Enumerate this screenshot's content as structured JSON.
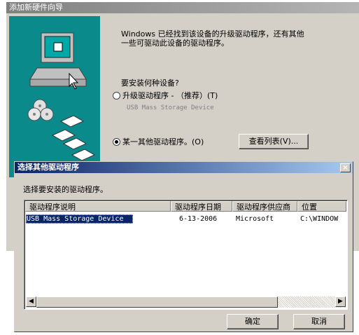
{
  "wizard": {
    "title": "添加新硬件向导",
    "message_line1": "Windows 已经找到该设备的升级驱动程序，还有其他",
    "message_line2": "一些可驱动此设备的驱动程序。",
    "question": "要安装何种设备?",
    "option_upgrade": "升级驱动程序 - （推荐）(T)",
    "option_upgrade_sub": "USB Mass Storage Device",
    "option_other": "某一其他驱动程序。(O)",
    "view_list_button": "查看列表(V)..."
  },
  "dialog": {
    "title": "选择其他驱动程序",
    "prompt": "选择要安装的驱动程序。",
    "close_glyph": "×",
    "columns": [
      "驱动程序说明",
      "驱动程序日期",
      "驱动程序供应商",
      "位置"
    ],
    "rows": [
      [
        "USB Mass Storage Device",
        "6-13-2006",
        "Microsoft",
        "C:\\WINDOW"
      ]
    ],
    "ok_button": "确定",
    "cancel_button": "取消",
    "scroll_left": "◀",
    "scroll_right": "▶"
  }
}
